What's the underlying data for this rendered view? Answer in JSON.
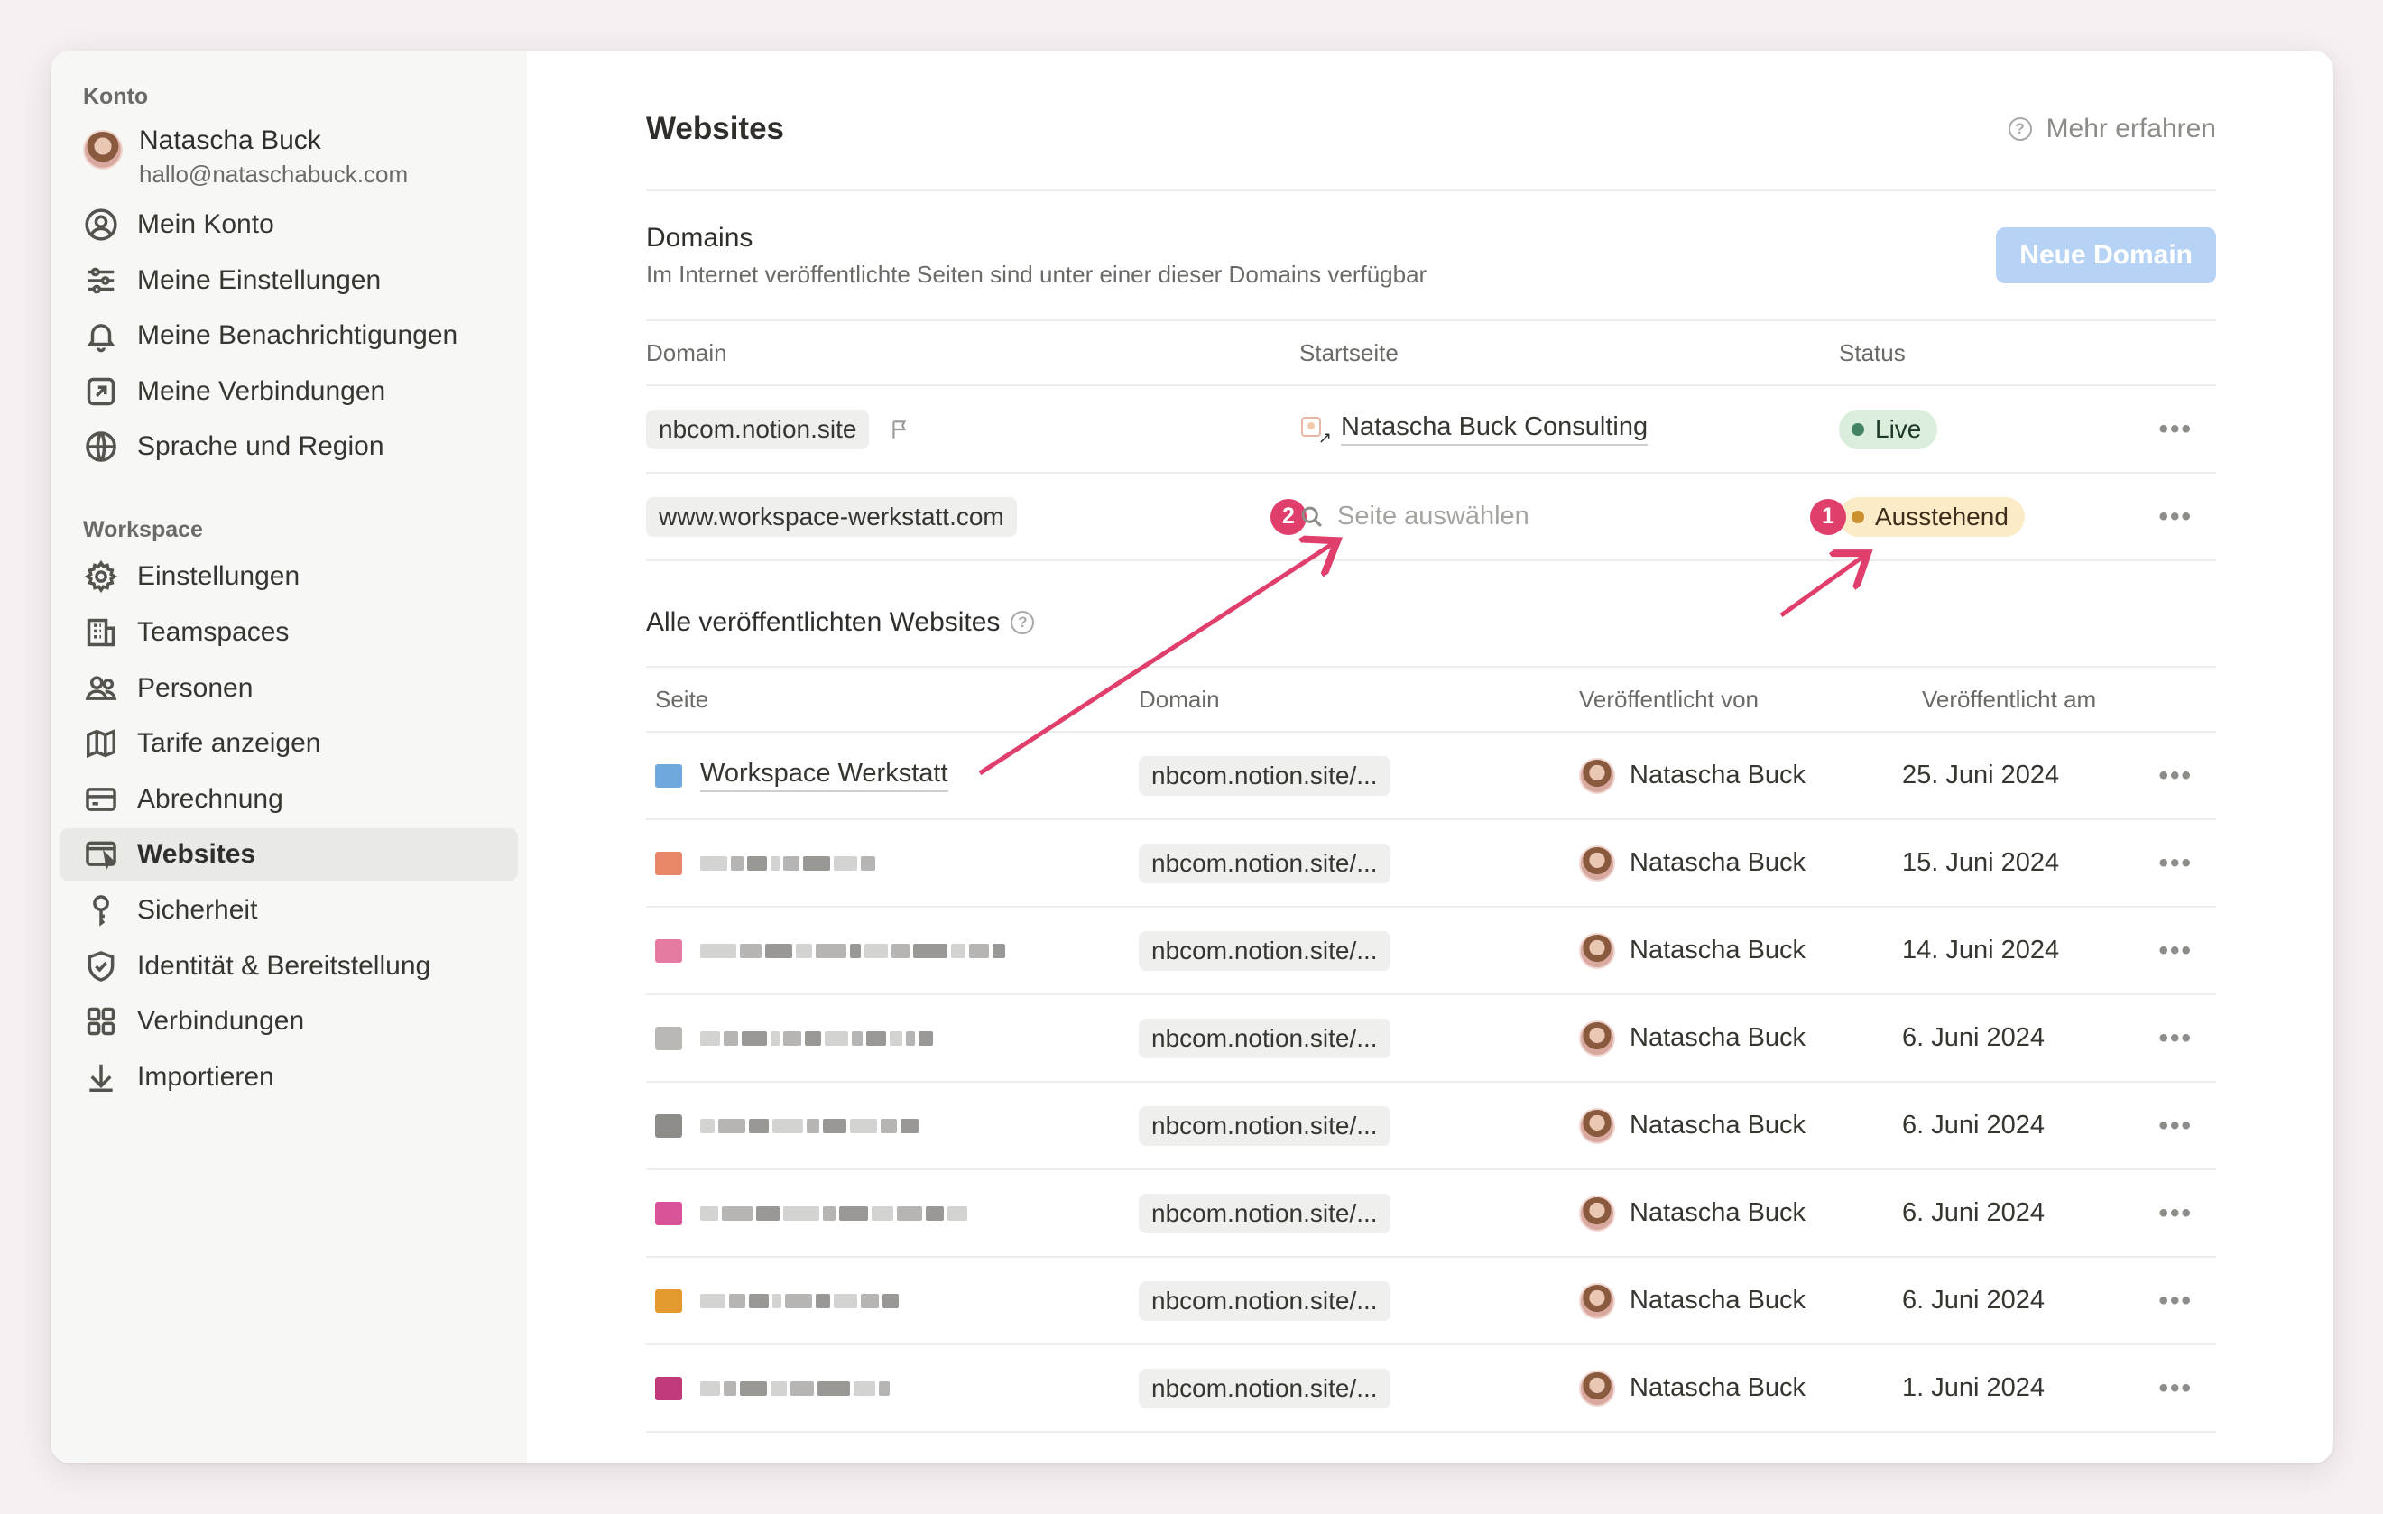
{
  "sidebar": {
    "account_section": "Konto",
    "user": {
      "name": "Natascha Buck",
      "email": "hallo@nataschabuck.com"
    },
    "account_items": [
      {
        "label": "Mein Konto",
        "icon": "user-circle-icon"
      },
      {
        "label": "Meine Einstellungen",
        "icon": "sliders-icon"
      },
      {
        "label": "Meine Benachrichtigungen",
        "icon": "bell-icon"
      },
      {
        "label": "Meine Verbindungen",
        "icon": "external-link-icon"
      },
      {
        "label": "Sprache und Region",
        "icon": "globe-icon"
      }
    ],
    "workspace_section": "Workspace",
    "workspace_items": [
      {
        "label": "Einstellungen",
        "icon": "gear-icon"
      },
      {
        "label": "Teamspaces",
        "icon": "building-icon"
      },
      {
        "label": "Personen",
        "icon": "people-icon"
      },
      {
        "label": "Tarife anzeigen",
        "icon": "map-icon"
      },
      {
        "label": "Abrechnung",
        "icon": "credit-card-icon"
      },
      {
        "label": "Websites",
        "icon": "browser-icon",
        "active": true
      },
      {
        "label": "Sicherheit",
        "icon": "key-icon"
      },
      {
        "label": "Identität & Bereitstellung",
        "icon": "shield-icon"
      },
      {
        "label": "Verbindungen",
        "icon": "grid-icon"
      },
      {
        "label": "Importieren",
        "icon": "download-icon"
      }
    ]
  },
  "main": {
    "title": "Websites",
    "learn_more": "Mehr erfahren",
    "domains": {
      "title": "Domains",
      "subtitle": "Im Internet veröffentlichte Seiten sind unter einer dieser Domains verfügbar",
      "new_button": "Neue Domain",
      "columns": [
        "Domain",
        "Startseite",
        "Status"
      ],
      "rows": [
        {
          "domain": "nbcom.notion.site",
          "start_page": "Natascha Buck Consulting",
          "status": "Live"
        },
        {
          "domain": "www.workspace-werkstatt.com",
          "start_page_placeholder": "Seite auswählen",
          "status": "Ausstehend"
        }
      ]
    },
    "annotations": {
      "marker_1": "1",
      "marker_2": "2"
    },
    "published": {
      "title": "Alle veröffentlichten Websites",
      "columns": [
        "Seite",
        "Domain",
        "Veröffentlicht von",
        "Veröffentlicht am"
      ],
      "rows": [
        {
          "page": "Workspace Werkstatt",
          "domain": "nbcom.notion.site/...",
          "by": "Natascha Buck",
          "date": "25. Juni 2024"
        },
        {
          "page": "",
          "domain": "nbcom.notion.site/...",
          "by": "Natascha Buck",
          "date": "15. Juni 2024"
        },
        {
          "page": "",
          "domain": "nbcom.notion.site/...",
          "by": "Natascha Buck",
          "date": "14. Juni 2024"
        },
        {
          "page": "",
          "domain": "nbcom.notion.site/...",
          "by": "Natascha Buck",
          "date": "6. Juni 2024"
        },
        {
          "page": "",
          "domain": "nbcom.notion.site/...",
          "by": "Natascha Buck",
          "date": "6. Juni 2024"
        },
        {
          "page": "",
          "domain": "nbcom.notion.site/...",
          "by": "Natascha Buck",
          "date": "6. Juni 2024"
        },
        {
          "page": "",
          "domain": "nbcom.notion.site/...",
          "by": "Natascha Buck",
          "date": "6. Juni 2024"
        },
        {
          "page": "",
          "domain": "nbcom.notion.site/...",
          "by": "Natascha Buck",
          "date": "1. Juni 2024"
        }
      ]
    }
  },
  "colors": {
    "accent_button": "#b6d3f5",
    "live_bg": "#dbeddb",
    "live_dot": "#448361",
    "pending_bg": "#fbecc7",
    "pending_dot": "#cb912f",
    "annotation": "#e03e6b"
  }
}
